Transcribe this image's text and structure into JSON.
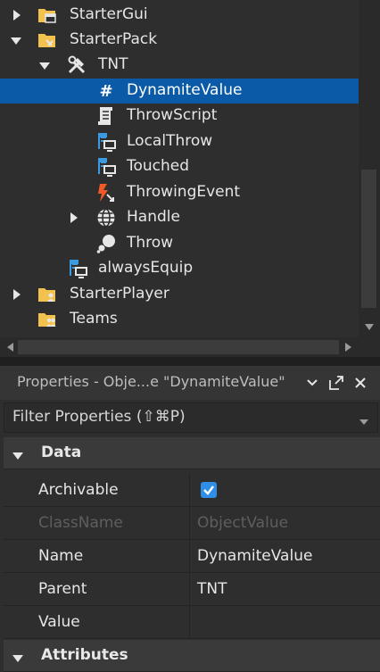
{
  "explorer": {
    "rows": [
      {
        "label": "StarterGui",
        "icon": "starter-gui-folder-icon",
        "expanded": false
      },
      {
        "label": "StarterPack",
        "icon": "starter-pack-folder-icon",
        "expanded": true
      },
      {
        "label": "TNT",
        "icon": "tool-icon",
        "expanded": true
      },
      {
        "label": "DynamiteValue",
        "icon": "object-value-icon",
        "selected": true
      },
      {
        "label": "ThrowScript",
        "icon": "script-icon"
      },
      {
        "label": "LocalThrow",
        "icon": "local-script-icon"
      },
      {
        "label": "Touched",
        "icon": "local-script-icon"
      },
      {
        "label": "ThrowingEvent",
        "icon": "remote-event-icon"
      },
      {
        "label": "Handle",
        "icon": "part-icon",
        "expanded": false
      },
      {
        "label": "Throw",
        "icon": "animation-icon"
      },
      {
        "label": "alwaysEquip",
        "icon": "local-script-icon"
      },
      {
        "label": "StarterPlayer",
        "icon": "starter-player-folder-icon",
        "expanded": false
      },
      {
        "label": "Teams",
        "icon": "teams-folder-icon"
      }
    ]
  },
  "properties": {
    "title": "Properties - Obje...e \"DynamiteValue\"",
    "filter_placeholder": "Filter Properties (⇧⌘P)",
    "categories": [
      {
        "label": "Data"
      },
      {
        "label": "Attributes"
      }
    ],
    "rows": [
      {
        "name": "Archivable",
        "value": "",
        "checked": true
      },
      {
        "name": "ClassName",
        "value": "ObjectValue",
        "disabled": true
      },
      {
        "name": "Name",
        "value": "DynamiteValue"
      },
      {
        "name": "Parent",
        "value": "TNT"
      },
      {
        "name": "Value",
        "value": ""
      }
    ]
  },
  "colors": {
    "background": "#2e2e2e",
    "selection": "#0b5aa8",
    "checkbox": "#2f8ee6",
    "folder": "#f2c14e",
    "script_blue": "#3a9be0",
    "event_orange": "#f05a28"
  }
}
